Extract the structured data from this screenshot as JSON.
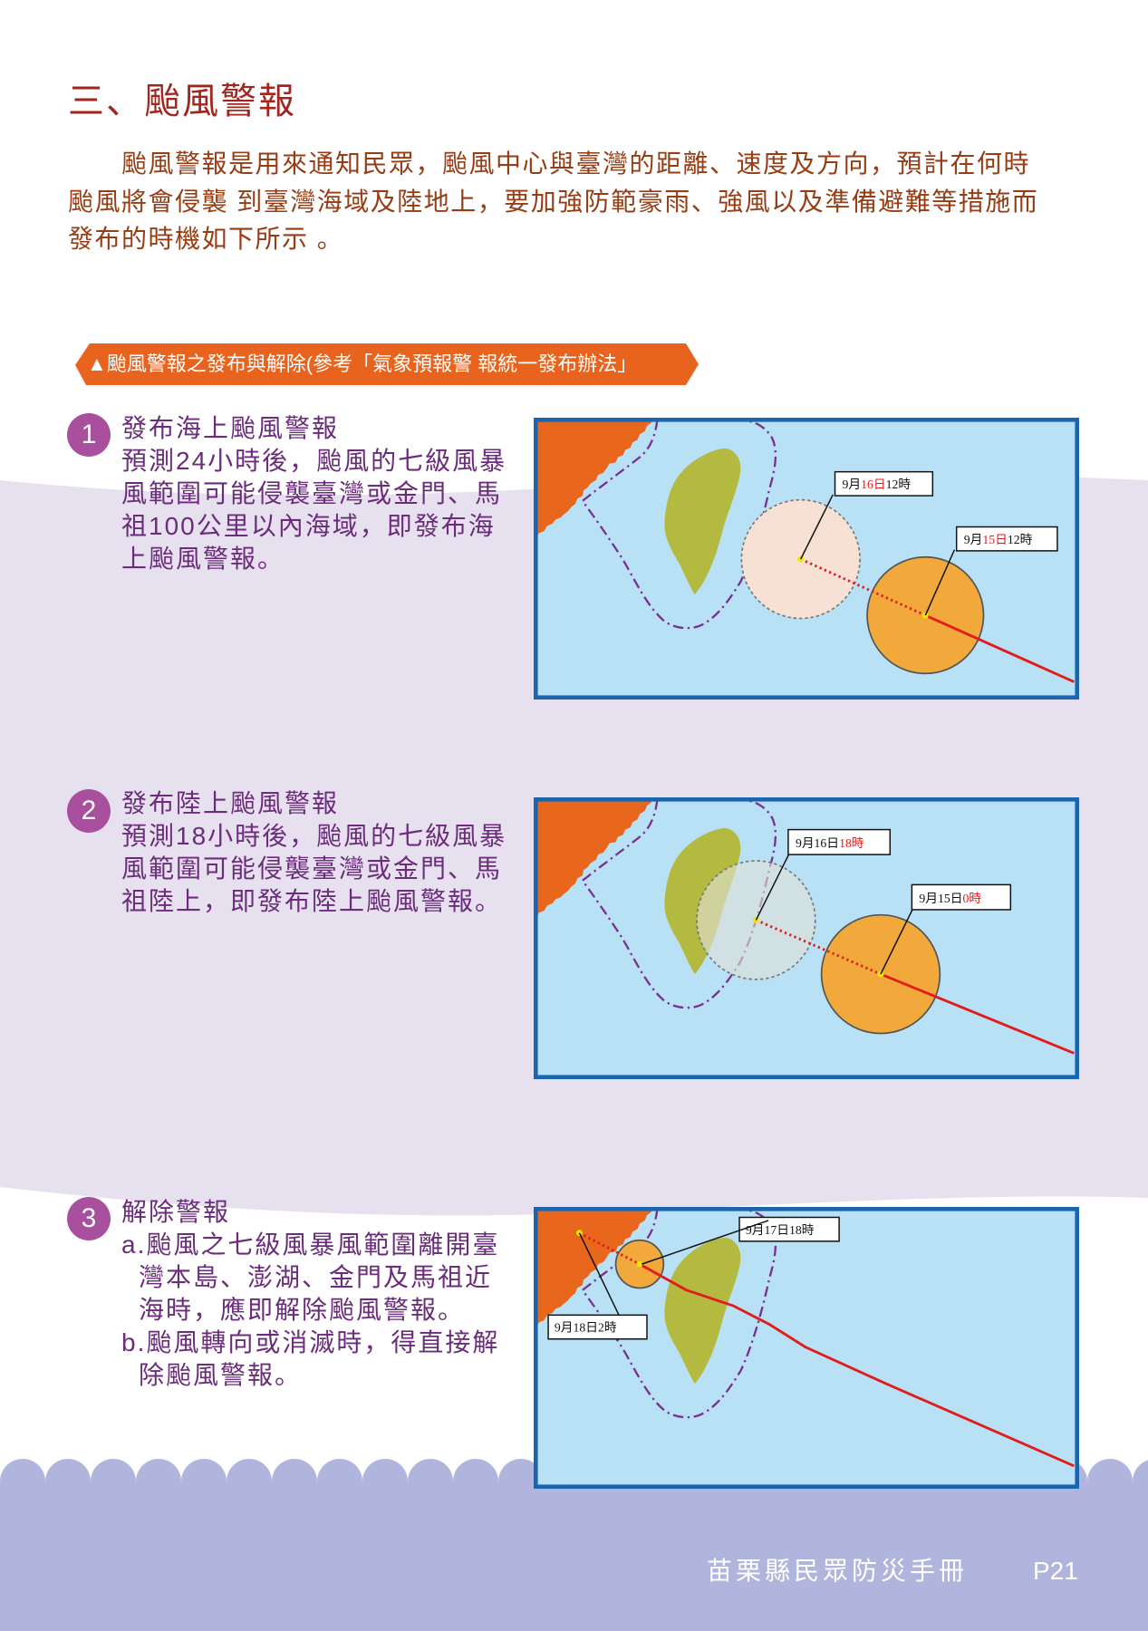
{
  "page": {
    "heading": "三、颱風警報",
    "intro_lines": [
      "颱風警報是用來通知民眾，颱風中心與臺灣的距離、速度及方向，預計在何時",
      "颱風將會侵襲 到臺灣海域及陸地上，要加強防範豪雨、強風以及準備避難等措施而",
      "發布的時機如下所示 。"
    ],
    "banner": "▲颱風警報之發布與解除(參考「氣象預報警 報統一發布辦法」"
  },
  "sections": [
    {
      "number": "1",
      "title": "發布海上颱風警報",
      "lines": [
        "預測24小時後，颱風的七級風暴",
        "風範圍可能侵襲臺灣或金門、馬",
        "祖100公里以內海域，即發布海",
        "上颱風警報。"
      ],
      "map": {
        "labels": [
          {
            "parts": [
              {
                "text": "9月",
                "red": false
              },
              {
                "text": "16日",
                "red": true
              },
              {
                "text": "12時",
                "red": false
              }
            ]
          },
          {
            "parts": [
              {
                "text": "9月",
                "red": false
              },
              {
                "text": "15日",
                "red": true
              },
              {
                "text": "12時",
                "red": false
              }
            ]
          }
        ]
      }
    },
    {
      "number": "2",
      "title": "發布陸上颱風警報",
      "lines": [
        "預測18小時後，颱風的七級風暴",
        "風範圍可能侵襲臺灣或金門、馬",
        "祖陸上，即發布陸上颱風警報。"
      ],
      "map": {
        "labels": [
          {
            "parts": [
              {
                "text": "9月16日",
                "red": false
              },
              {
                "text": "18時",
                "red": true
              }
            ]
          },
          {
            "parts": [
              {
                "text": "9月15日",
                "red": false
              },
              {
                "text": "0時",
                "red": true
              }
            ]
          }
        ]
      }
    },
    {
      "number": "3",
      "title": "解除警報",
      "items": [
        {
          "lines": [
            "a.颱風之七級風暴風範圍離開臺",
            "灣本島、澎湖、金門及馬祖近",
            "海時，應即解除颱風警報。"
          ]
        },
        {
          "lines": [
            "b.颱風轉向或消滅時，得直接解",
            "除颱風警報。"
          ]
        }
      ],
      "map": {
        "labels": [
          {
            "parts": [
              {
                "text": "9月17日18時",
                "red": false
              }
            ]
          },
          {
            "parts": [
              {
                "text": "9月18日2時",
                "red": false
              }
            ]
          }
        ]
      }
    }
  ],
  "footer": {
    "title": "苗栗縣民眾防災手冊",
    "page": "P21"
  },
  "colors": {
    "heading": "#a2261f",
    "intro-text": "#983c14",
    "section-text": "#6b2c7c",
    "number-badge": "#a8509e",
    "banner": "#e8641e",
    "band": "#e7e1ef",
    "footer": "#afb5dc",
    "sea": "#b9e1f6",
    "map-frame": "#1b64ae",
    "mainland": "#e8671c",
    "taiwan": "#b3ba3f",
    "typhoon": "#f2a93c",
    "track": "#e21b1b",
    "highlight": "#e21b1b",
    "warning-zone": "#7a2f8e"
  }
}
